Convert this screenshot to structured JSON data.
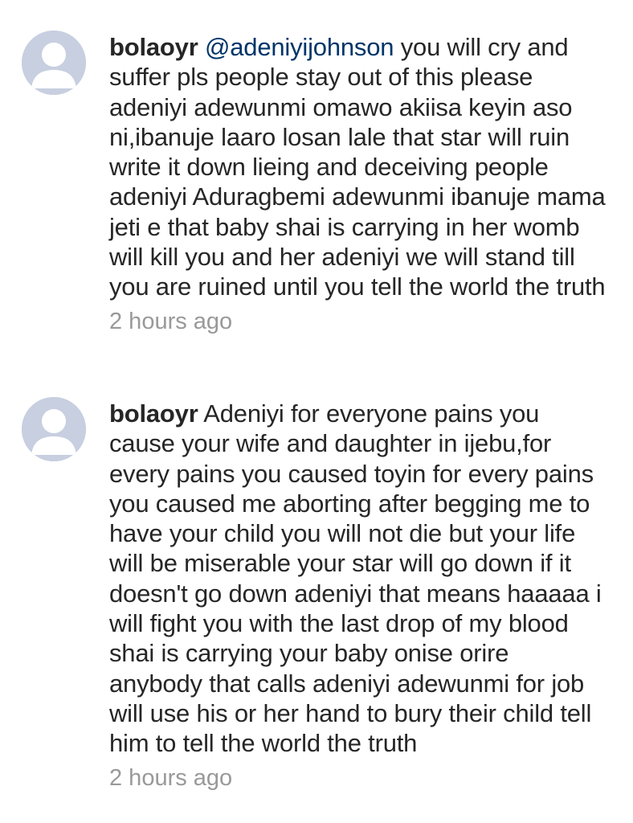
{
  "comments": [
    {
      "username": "bolaoyr",
      "mention": "@adeniyijohnson",
      "text": " you will cry and suffer pls people stay out of this please adeniyi adewunmi omawo akiisa keyin aso ni,ibanuje laaro losan lale that star will ruin write it down lieing and deceiving people adeniyi Aduragbemi adewunmi ibanuje mama jeti e that baby shai is carrying in her womb will kill you and her adeniyi we will stand till you are ruined until you tell the world the truth",
      "timestamp": "2 hours ago"
    },
    {
      "username": "bolaoyr",
      "mention": "",
      "text": " Adeniyi for everyone pains you cause your wife and daughter in ijebu,for every pains you caused toyin for every pains you caused me aborting after begging me to have your child you will not die but your life will be miserable your star will go down if it doesn't go down adeniyi that means haaaaa i will fight you with the last drop of my blood shai is carrying your baby onise orire anybody that calls adeniyi adewunmi for job will use his or her hand to bury their child tell him to tell the world the truth",
      "timestamp": "2 hours ago"
    }
  ],
  "icons": {
    "avatar": "default-profile-avatar-icon"
  },
  "colors": {
    "text": "#262626",
    "mention": "#003569",
    "timestamp": "#999999",
    "avatar_bg": "#c7cfe0"
  }
}
